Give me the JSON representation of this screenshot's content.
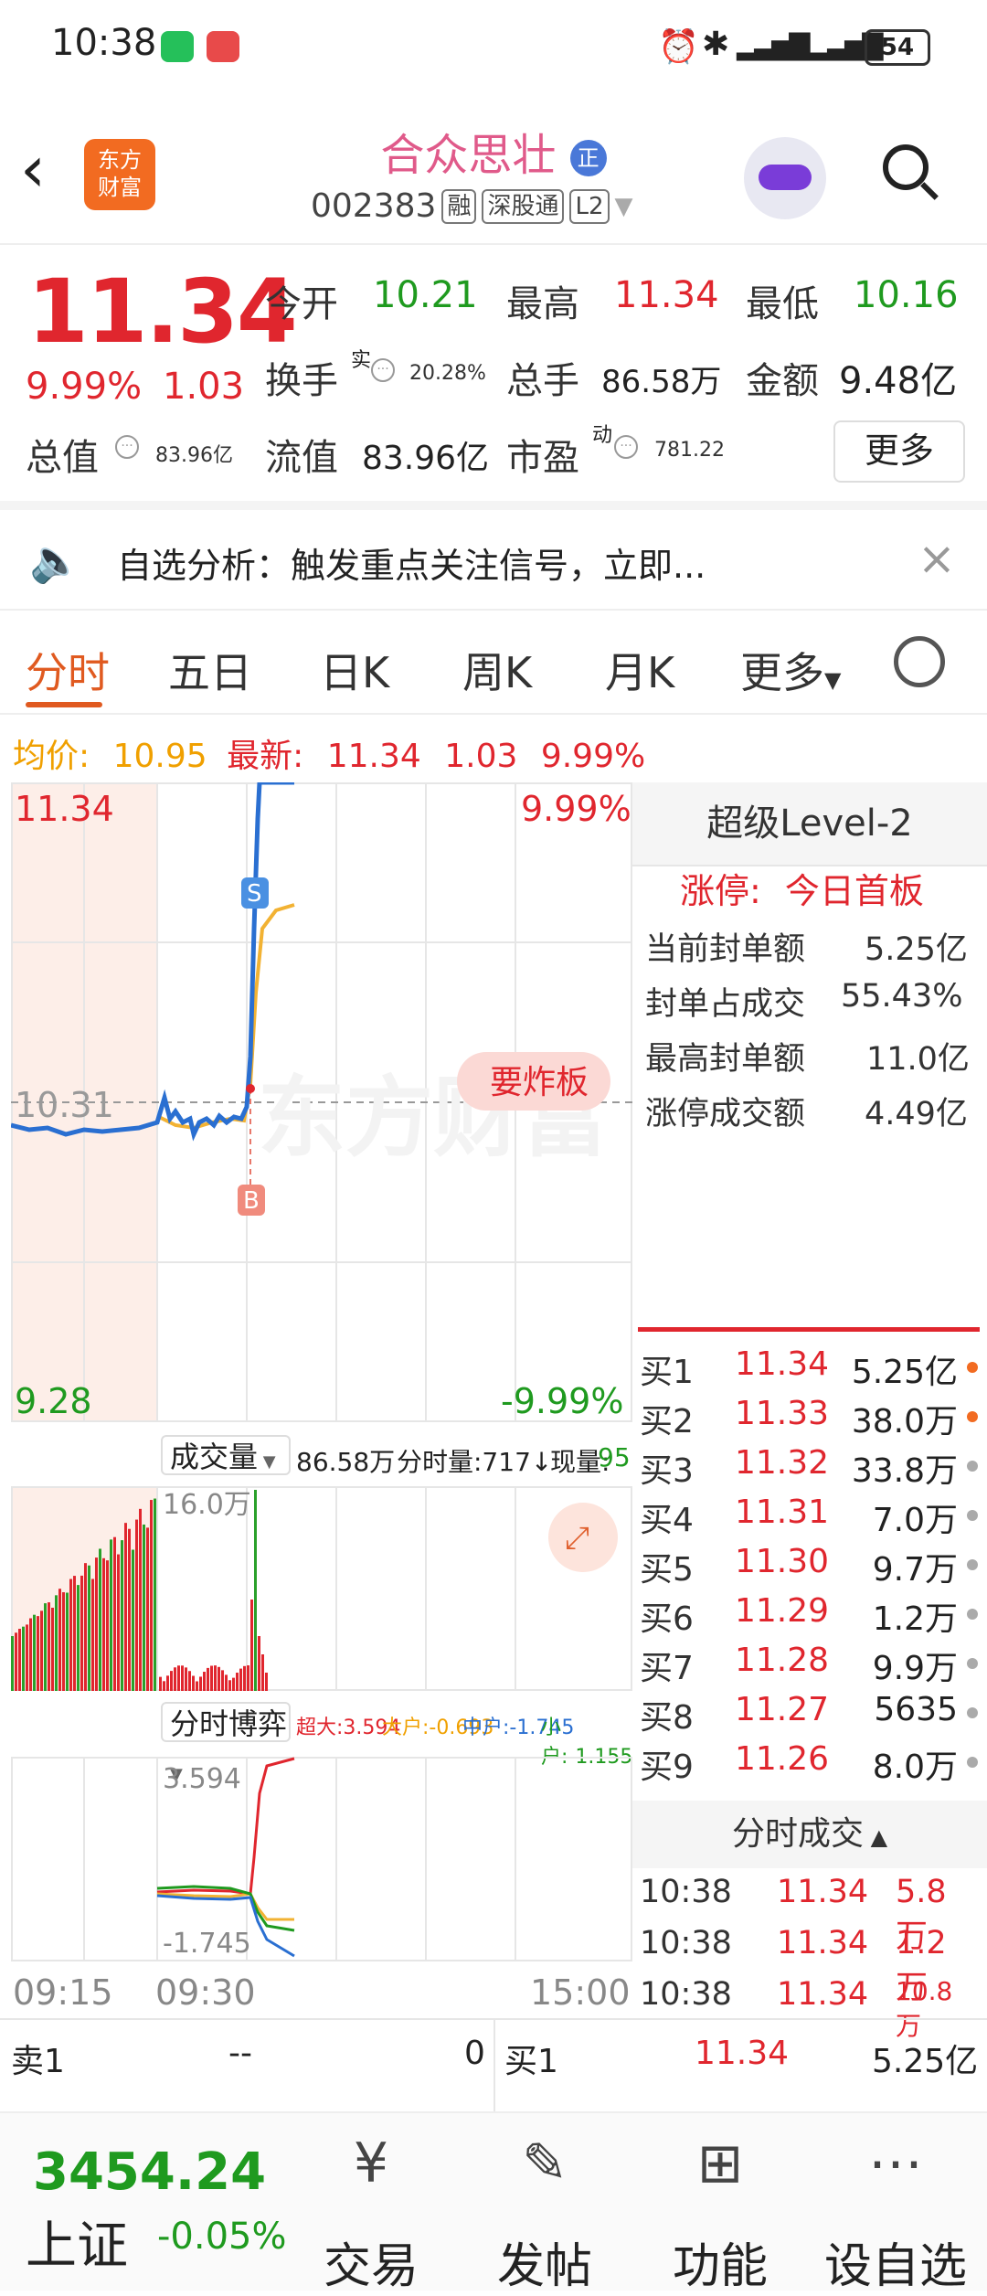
{
  "status_bar": {
    "time": "10:38",
    "battery": "54"
  },
  "header": {
    "logo_line1": "东方",
    "logo_line2": "财富",
    "stock_name": "合众思壮",
    "stock_badge": "正",
    "stock_code": "002383",
    "tags": [
      "融",
      "深股通",
      "L2"
    ]
  },
  "quote": {
    "price": "11.34",
    "change_pct": "9.99%",
    "change": "1.03",
    "open_label": "今开",
    "open": "10.21",
    "high_label": "最高",
    "high": "11.34",
    "low_label": "最低",
    "low": "10.16",
    "turnover_label": "换手",
    "turnover_sup": "实",
    "turnover": "20.28%",
    "volume_label": "总手",
    "volume": "86.58万",
    "amount_label": "金额",
    "amount": "9.48亿",
    "mcap_label": "总值",
    "mcap": "83.96亿",
    "float_label": "流值",
    "float": "83.96亿",
    "pe_label": "市盈",
    "pe_sup": "动",
    "pe": "781.22",
    "more_label": "更多"
  },
  "banner": {
    "text": "自选分析：触发重点关注信号，立即..."
  },
  "tabs": [
    "分时",
    "五日",
    "日K",
    "周K",
    "月K",
    "更多"
  ],
  "avg_row": {
    "avg_label": "均价:",
    "avg": "10.95",
    "latest_label": "最新:",
    "latest": "11.34",
    "chg": "1.03",
    "pct": "9.99%"
  },
  "chart_labels": {
    "top_price": "11.34",
    "top_pct": "9.99%",
    "mid_price": "10.31",
    "bottom_price": "9.28",
    "bottom_pct": "-9.99%",
    "tag_bomb": "要炸板",
    "marker_sell": "S",
    "marker_buy": "B",
    "watermark": "东方财富"
  },
  "volume_panel": {
    "title": "成交量",
    "total": "86.58万",
    "tick_count": "分时量:717↓",
    "now_label": "现量:",
    "now": "95",
    "scale": "16.0万"
  },
  "game_panel": {
    "title": "分时博弈",
    "super": "超大:3.594",
    "big": "大户:-0.693",
    "mid": "中户:-1.745",
    "small": "小户:-1.155",
    "top": "3.594",
    "bottom": "-1.745"
  },
  "time_axis": [
    "09:15",
    "09:30",
    "15:00"
  ],
  "level2": {
    "title": "超级Level-2",
    "limit_label": "涨停:",
    "limit_value": "今日首板",
    "rows": [
      {
        "label": "当前封单额",
        "value": "5.25亿"
      },
      {
        "label": "封单占成交",
        "value": "55.43%"
      },
      {
        "label": "最高封单额",
        "value": "11.0亿"
      },
      {
        "label": "涨停成交额",
        "value": "4.49亿"
      }
    ]
  },
  "bids": [
    {
      "label": "买1",
      "price": "11.34",
      "vol": "5.25亿"
    },
    {
      "label": "买2",
      "price": "11.33",
      "vol": "38.0万"
    },
    {
      "label": "买3",
      "price": "11.32",
      "vol": "33.8万"
    },
    {
      "label": "买4",
      "price": "11.31",
      "vol": "7.0万"
    },
    {
      "label": "买5",
      "price": "11.30",
      "vol": "9.7万"
    },
    {
      "label": "买6",
      "price": "11.29",
      "vol": "1.2万"
    },
    {
      "label": "买7",
      "price": "11.28",
      "vol": "9.9万"
    },
    {
      "label": "买8",
      "price": "11.27",
      "vol": "5635"
    },
    {
      "label": "买9",
      "price": "11.26",
      "vol": "8.0万"
    }
  ],
  "ticks": {
    "title": "分时成交",
    "rows": [
      {
        "time": "10:38",
        "price": "11.34",
        "vol": "5.8万"
      },
      {
        "time": "10:38",
        "price": "11.34",
        "vol": "1.2万"
      },
      {
        "time": "10:38",
        "price": "11.34",
        "vol": "10.8万"
      }
    ]
  },
  "bottom_quote": {
    "sell_label": "卖1",
    "sell_price": "--",
    "sell_vol": "0",
    "buy_label": "买1",
    "buy_price": "11.34",
    "buy_vol": "5.25亿"
  },
  "nav": {
    "index_value": "3454.24",
    "index_name": "上证",
    "index_change": "-0.05%",
    "items": [
      "交易",
      "发帖",
      "功能",
      "设自选"
    ]
  }
}
